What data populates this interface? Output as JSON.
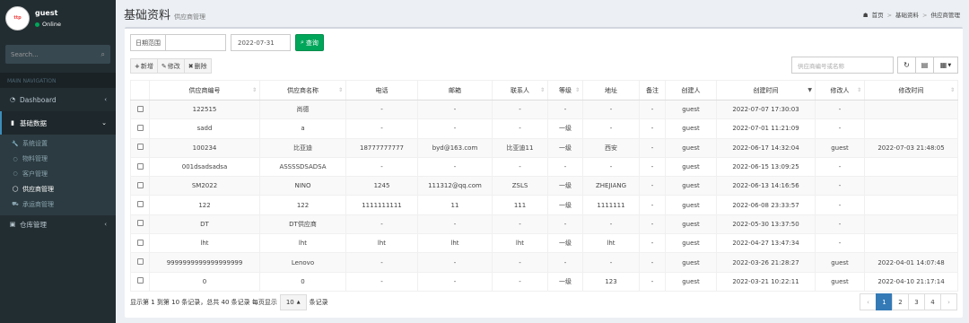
{
  "user": {
    "name": "guest",
    "status": "Online",
    "avatar_label": "ttp"
  },
  "sidebar": {
    "search_placeholder": "Search...",
    "header": "MAIN NAVIGATION",
    "dashboard": "Dashboard",
    "basic": "基础数据",
    "sub_items": [
      {
        "label": "系统设置",
        "icon": "wrench-icon"
      },
      {
        "label": "物料管理",
        "icon": "circle-icon"
      },
      {
        "label": "客户管理",
        "icon": "circle-icon"
      },
      {
        "label": "供应商管理",
        "icon": "circle-icon"
      },
      {
        "label": "承运商管理",
        "icon": "truck-icon"
      }
    ],
    "warehouse": "仓库管理"
  },
  "header": {
    "title": "基础资料",
    "subtitle": "供应商管理",
    "breadcrumb": [
      "首页",
      "基础资料",
      "供应商管理"
    ]
  },
  "filters": {
    "date_label": "日期范围",
    "date_value": "",
    "date_end": "2022-07-31",
    "query": "查询"
  },
  "toolbar": {
    "add": "新增",
    "edit": "修改",
    "delete": "删除"
  },
  "search": {
    "placeholder": "供应商编号或名称"
  },
  "table": {
    "columns": [
      "",
      "供应商编号",
      "供应商名称",
      "电话",
      "邮箱",
      "联系人",
      "等级",
      "地址",
      "备注",
      "创建人",
      "创建时间",
      "修改人",
      "修改时间"
    ],
    "rows": [
      [
        "122515",
        "尚德",
        "-",
        "-",
        "-",
        "-",
        "-",
        "-",
        "guest",
        "2022-07-07 17:30:03",
        "-",
        ""
      ],
      [
        "sadd",
        "a",
        "-",
        "-",
        "-",
        "一级",
        "-",
        "-",
        "guest",
        "2022-07-01 11:21:09",
        "-",
        ""
      ],
      [
        "100234",
        "比亚迪",
        "18777777777",
        "byd@163.com",
        "比亚迪11",
        "一级",
        "西安",
        "-",
        "guest",
        "2022-06-17 14:32:04",
        "guest",
        "2022-07-03 21:48:05"
      ],
      [
        "001dsadsadsa",
        "ASSSSDSADSA",
        "-",
        "-",
        "-",
        "-",
        "-",
        "-",
        "guest",
        "2022-06-15 13:09:25",
        "-",
        ""
      ],
      [
        "SM2022",
        "NINO",
        "1245",
        "111312@qq.com",
        "ZSLS",
        "一级",
        "ZHEJIANG",
        "-",
        "guest",
        "2022-06-13 14:16:56",
        "-",
        ""
      ],
      [
        "122",
        "122",
        "1111111111",
        "11",
        "111",
        "一级",
        "1111111",
        "-",
        "guest",
        "2022-06-08 23:33:57",
        "-",
        ""
      ],
      [
        "DT",
        "DT供应商",
        "-",
        "-",
        "-",
        "-",
        "-",
        "-",
        "guest",
        "2022-05-30 13:37:50",
        "-",
        ""
      ],
      [
        "lht",
        "lht",
        "lht",
        "lht",
        "lht",
        "一级",
        "lht",
        "-",
        "guest",
        "2022-04-27 13:47:34",
        "-",
        ""
      ],
      [
        "9999999999999999999",
        "Lenovo",
        "-",
        "-",
        "-",
        "-",
        "-",
        "-",
        "guest",
        "2022-03-26 21:28:27",
        "guest",
        "2022-04-01 14:07:48"
      ],
      [
        "0",
        "0",
        "-",
        "-",
        "-",
        "一级",
        "123",
        "-",
        "guest",
        "2022-03-21 10:22:11",
        "guest",
        "2022-04-10 21:17:14"
      ]
    ]
  },
  "pager": {
    "info_prefix": "显示第 1 到第 10 条记录，总共 40 条记录 每页显示",
    "page_size": "10",
    "info_suffix": "条记录",
    "pages": [
      "1",
      "2",
      "3",
      "4"
    ],
    "prev": "‹",
    "next": "›"
  }
}
